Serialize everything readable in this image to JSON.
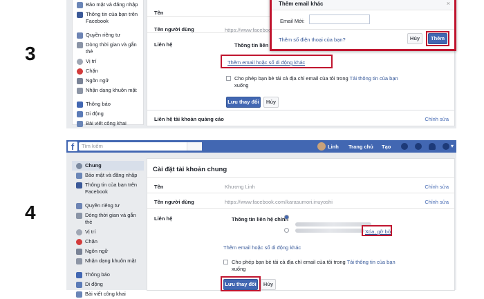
{
  "steps": [
    "3",
    "4"
  ],
  "colors": {
    "fb_blue": "#4267b2",
    "highlight_red": "#c0152f",
    "page_bg": "#e9ebee"
  },
  "top": {
    "sidebar": [
      {
        "label": "Bảo mật và đăng nhập",
        "icon": "shield-icon"
      },
      {
        "label": "Thông tin của bạn trên Facebook",
        "icon": "facebook-icon"
      },
      {
        "label": "Quyền riêng tư",
        "icon": "lock-icon"
      },
      {
        "label": "Dòng thời gian và gắn thẻ",
        "icon": "timeline-icon"
      },
      {
        "label": "Vị trí",
        "icon": "location-icon"
      },
      {
        "label": "Chặn",
        "icon": "block-icon"
      },
      {
        "label": "Ngôn ngữ",
        "icon": "language-icon"
      },
      {
        "label": "Nhận dạng khuôn mặt",
        "icon": "face-icon"
      },
      {
        "label": "Thông báo",
        "icon": "notification-icon"
      },
      {
        "label": "Di động",
        "icon": "mobile-icon"
      },
      {
        "label": "Bài viết công khai",
        "icon": "public-posts-icon"
      }
    ],
    "rows": {
      "name_label": "Tên",
      "username_label": "Tên người dùng",
      "username_value": "https://www.facebook",
      "contact_label": "Liên hệ",
      "contact_primary": "Thông tin liên h",
      "add_email_link": "Thêm email hoặc số di động khác",
      "allow_text": "Cho phép bạn bè tải cả địa chỉ email của tôi trong ",
      "allow_link": "Tải thông tin của bạn",
      "allow_tail": "xuống",
      "save": "Lưu thay đổi",
      "cancel": "Hủy",
      "ads_label": "Liên hệ tài khoản quảng cáo",
      "edit": "Chỉnh sửa"
    },
    "dialog": {
      "title": "Thêm email khác",
      "new_email_label": "Email Mới:",
      "phone_link": "Thêm số điện thoại của bạn?",
      "cancel": "Hủy",
      "add": "Thêm"
    }
  },
  "bottom": {
    "search_placeholder": "Tìm kiếm",
    "user_name": "Linh",
    "nav_home": "Trang chủ",
    "nav_create": "Tạo",
    "sidebar": [
      {
        "label": "Chung",
        "icon": "gear-icon",
        "active": true
      },
      {
        "label": "Bảo mật và đăng nhập",
        "icon": "shield-icon"
      },
      {
        "label": "Thông tin của bạn trên Facebook",
        "icon": "facebook-icon"
      },
      {
        "label": "Quyền riêng tư",
        "icon": "lock-icon"
      },
      {
        "label": "Dòng thời gian và gắn thẻ",
        "icon": "timeline-icon"
      },
      {
        "label": "Vị trí",
        "icon": "location-icon"
      },
      {
        "label": "Chặn",
        "icon": "block-icon"
      },
      {
        "label": "Ngôn ngữ",
        "icon": "language-icon"
      },
      {
        "label": "Nhận dạng khuôn mặt",
        "icon": "face-icon"
      },
      {
        "label": "Thông báo",
        "icon": "notification-icon"
      },
      {
        "label": "Di động",
        "icon": "mobile-icon"
      },
      {
        "label": "Bài viết công khai",
        "icon": "public-posts-icon"
      }
    ],
    "title": "Cài đặt tài khoản chung",
    "name_label": "Tên",
    "name_value": "Khương Linh",
    "username_label": "Tên người dùng",
    "username_value": "https://www.facebook.com/karasumori.inuyoshi",
    "contact_label": "Liên hệ",
    "contact_primary": "Thông tin liên hệ chính",
    "remove_link": "Xóa, gỡ bỏ",
    "add_email_link": "Thêm email hoặc số di động khác",
    "allow_text": "Cho phép bạn bè tải cả địa chỉ email của tôi trong ",
    "allow_link": "Tải thông tin của bạn",
    "allow_tail": "xuống",
    "save": "Lưu thay đổi",
    "cancel": "Hủy",
    "edit": "Chỉnh sửa"
  }
}
